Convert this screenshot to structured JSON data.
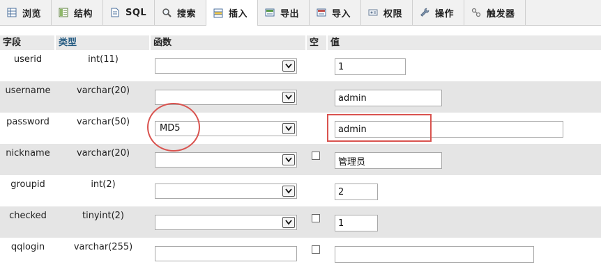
{
  "tabs": [
    {
      "label": "浏览",
      "icon": "table-browse-icon"
    },
    {
      "label": "结构",
      "icon": "structure-icon"
    },
    {
      "label": "SQL",
      "icon": "sql-document-icon"
    },
    {
      "label": "搜索",
      "icon": "search-icon"
    },
    {
      "label": "插入",
      "icon": "insert-row-icon",
      "active": true
    },
    {
      "label": "导出",
      "icon": "export-icon"
    },
    {
      "label": "导入",
      "icon": "import-icon"
    },
    {
      "label": "权限",
      "icon": "privileges-icon"
    },
    {
      "label": "操作",
      "icon": "wrench-icon"
    },
    {
      "label": "触发器",
      "icon": "triggers-icon"
    }
  ],
  "columns": {
    "field": "字段",
    "type": "类型",
    "function": "函数",
    "null": "空",
    "value": "值"
  },
  "rows": [
    {
      "name": "userid",
      "type": "int(11)",
      "function": "",
      "null_checkbox": false,
      "value": "1"
    },
    {
      "name": "username",
      "type": "varchar(20)",
      "function": "",
      "null_checkbox": false,
      "value": "admin"
    },
    {
      "name": "password",
      "type": "varchar(50)",
      "function": "MD5",
      "null_checkbox": false,
      "value": "admin"
    },
    {
      "name": "nickname",
      "type": "varchar(20)",
      "function": "",
      "null_checkbox": true,
      "value": "管理员"
    },
    {
      "name": "groupid",
      "type": "int(2)",
      "function": "",
      "null_checkbox": false,
      "value": "2"
    },
    {
      "name": "checked",
      "type": "tinyint(2)",
      "function": "",
      "null_checkbox": true,
      "value": "1"
    },
    {
      "name": "qqlogin",
      "type": "varchar(255)",
      "function": "",
      "null_checkbox": true,
      "value": ""
    }
  ],
  "annotation_color": "#d9534f"
}
